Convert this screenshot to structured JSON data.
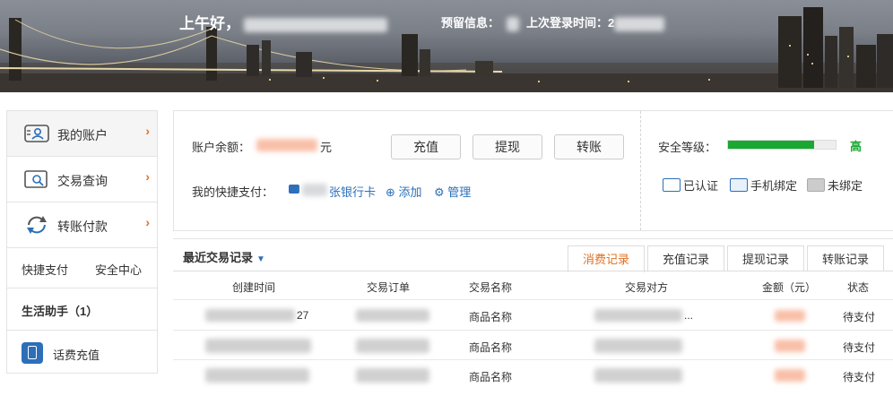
{
  "header": {
    "greeting": "上午好，",
    "reserved_info_label": "预留信息：",
    "last_login_label": "上次登录时间：2"
  },
  "sidebar": {
    "items": [
      {
        "label": "我的账户",
        "arrow": "›"
      },
      {
        "label": "交易查询",
        "arrow": "›"
      },
      {
        "label": "转账付款",
        "arrow": "›"
      }
    ],
    "quick_pay": "快捷支付",
    "security_center": "安全中心",
    "life_helper": "生活助手（1）",
    "phone_recharge": "话费充值"
  },
  "account": {
    "balance_label": "账户余额：",
    "currency": "元",
    "buttons": [
      "充值",
      "提现",
      "转账"
    ],
    "quickpay_label": "我的快捷支付：",
    "bank_cards": "张银行卡",
    "add_link": "添加",
    "manage_link": "管理",
    "security_label": "安全等级：",
    "security_level": "高",
    "security_fraction": 0.8,
    "verified": "已认证",
    "phone_bound": "手机绑定",
    "unbound": "未绑定"
  },
  "records": {
    "title": "最近交易记录",
    "tabs": [
      "消费记录",
      "充值记录",
      "提现记录",
      "转账记录"
    ],
    "columns": [
      "创建时间",
      "交易订单",
      "交易名称",
      "交易对方",
      "金额（元）",
      "状态"
    ],
    "rows": [
      {
        "time_suffix": "27",
        "name": "商品名称",
        "party_suffix": "...",
        "status": "待支付"
      },
      {
        "time_suffix": "",
        "name": "商品名称",
        "party_suffix": "",
        "status": "待支付"
      },
      {
        "time_suffix": "",
        "name": "商品名称",
        "party_suffix": "",
        "status": "待支付"
      }
    ]
  },
  "colors": {
    "accent_orange": "#e07020",
    "link_blue": "#2d6fb8",
    "security_green": "#19a832"
  }
}
